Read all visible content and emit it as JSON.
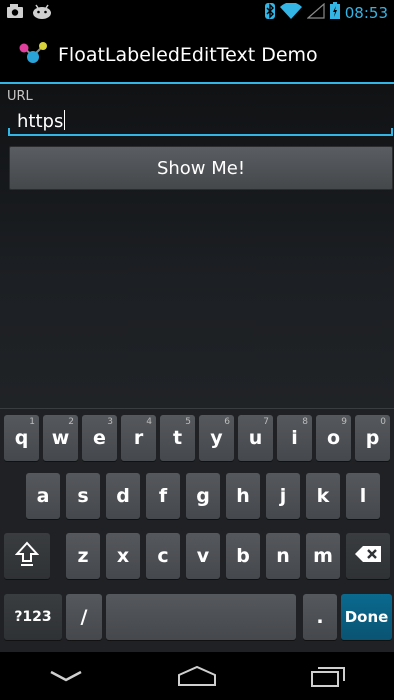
{
  "status_bar": {
    "time": "08:53",
    "icons": [
      "photo-notification-icon",
      "android-notification-icon",
      "bluetooth-icon",
      "wifi-icon",
      "signal-icon",
      "battery-icon"
    ]
  },
  "action_bar": {
    "app_title": "FloatLabeledEditText Demo",
    "app_icon": "molecule-app-icon"
  },
  "form": {
    "url_label": "URL",
    "url_value": "https",
    "button_label": "Show Me!"
  },
  "keyboard": {
    "row1": [
      {
        "label": "q",
        "hint": "1"
      },
      {
        "label": "w",
        "hint": "2"
      },
      {
        "label": "e",
        "hint": "3"
      },
      {
        "label": "r",
        "hint": "4"
      },
      {
        "label": "t",
        "hint": "5"
      },
      {
        "label": "y",
        "hint": "6"
      },
      {
        "label": "u",
        "hint": "7"
      },
      {
        "label": "i",
        "hint": "8"
      },
      {
        "label": "o",
        "hint": "9"
      },
      {
        "label": "p",
        "hint": "0"
      }
    ],
    "row2": [
      "a",
      "s",
      "d",
      "f",
      "g",
      "h",
      "j",
      "k",
      "l"
    ],
    "row3": [
      "z",
      "x",
      "c",
      "v",
      "b",
      "n",
      "m"
    ],
    "symbols_label": "?123",
    "slash_label": "/",
    "period_label": ".",
    "done_label": "Done",
    "shift_icon": "shift-icon",
    "backspace_icon": "backspace-icon"
  },
  "nav_bar": {
    "icons": [
      "back-icon",
      "home-icon",
      "recents-icon"
    ]
  },
  "colors": {
    "accent": "#33b5e5",
    "done_key": "#0a5f82"
  }
}
